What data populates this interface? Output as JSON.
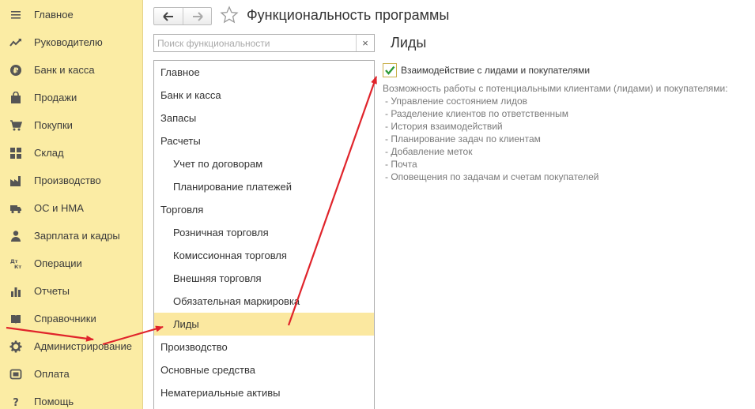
{
  "sidebar": {
    "items": [
      {
        "label": "Главное",
        "icon": "menu-lines-icon"
      },
      {
        "label": "Руководителю",
        "icon": "trend-chart-icon"
      },
      {
        "label": "Банк и касса",
        "icon": "ruble-coin-icon"
      },
      {
        "label": "Продажи",
        "icon": "shopping-bag-icon"
      },
      {
        "label": "Покупки",
        "icon": "cart-icon"
      },
      {
        "label": "Склад",
        "icon": "warehouse-grid-icon"
      },
      {
        "label": "Производство",
        "icon": "factory-icon"
      },
      {
        "label": "ОС и НМА",
        "icon": "truck-icon"
      },
      {
        "label": "Зарплата и кадры",
        "icon": "person-icon"
      },
      {
        "label": "Операции",
        "icon": "debit-credit-icon"
      },
      {
        "label": "Отчеты",
        "icon": "bar-chart-icon"
      },
      {
        "label": "Справочники",
        "icon": "book-icon"
      },
      {
        "label": "Администрирование",
        "icon": "gear-icon"
      },
      {
        "label": "Оплата",
        "icon": "payment-icon"
      },
      {
        "label": "Помощь",
        "icon": "question-icon"
      }
    ]
  },
  "header": {
    "title": "Функциональность программы"
  },
  "search": {
    "placeholder": "Поиск функциональности",
    "value": "",
    "clear_label": "×"
  },
  "sections": [
    {
      "label": "Главное",
      "level": 0,
      "selected": false
    },
    {
      "label": "Банк и касса",
      "level": 0,
      "selected": false
    },
    {
      "label": "Запасы",
      "level": 0,
      "selected": false
    },
    {
      "label": "Расчеты",
      "level": 0,
      "selected": false
    },
    {
      "label": "Учет по договорам",
      "level": 1,
      "selected": false
    },
    {
      "label": "Планирование платежей",
      "level": 1,
      "selected": false
    },
    {
      "label": "Торговля",
      "level": 0,
      "selected": false
    },
    {
      "label": "Розничная торговля",
      "level": 1,
      "selected": false
    },
    {
      "label": "Комиссионная торговля",
      "level": 1,
      "selected": false
    },
    {
      "label": "Внешняя торговля",
      "level": 1,
      "selected": false
    },
    {
      "label": "Обязательная маркировка",
      "level": 1,
      "selected": false
    },
    {
      "label": "Лиды",
      "level": 1,
      "selected": true
    },
    {
      "label": "Производство",
      "level": 0,
      "selected": false
    },
    {
      "label": "Основные средства",
      "level": 0,
      "selected": false
    },
    {
      "label": "Нематериальные активы",
      "level": 0,
      "selected": false
    }
  ],
  "panel": {
    "section_title": "Лиды",
    "option": {
      "checked": true,
      "label": "Взаимодействие с лидами и покупателями"
    },
    "description": {
      "intro": "Возможность работы с потенциальными клиентами (лидами) и покупателями:",
      "bullets": [
        "- Управление состоянием лидов",
        "- Разделение клиентов по ответственным",
        "- История взаимодействий",
        "- Планирование задач по клиентам",
        "- Добавление меток",
        "- Почта",
        "- Оповещения по задачам и счетам покупателей"
      ]
    }
  },
  "colors": {
    "sidebar_bg": "#fbeca4",
    "selected_row": "#fbe8a0",
    "checkmark": "#2e9b3a",
    "arrow": "#e0242b"
  }
}
